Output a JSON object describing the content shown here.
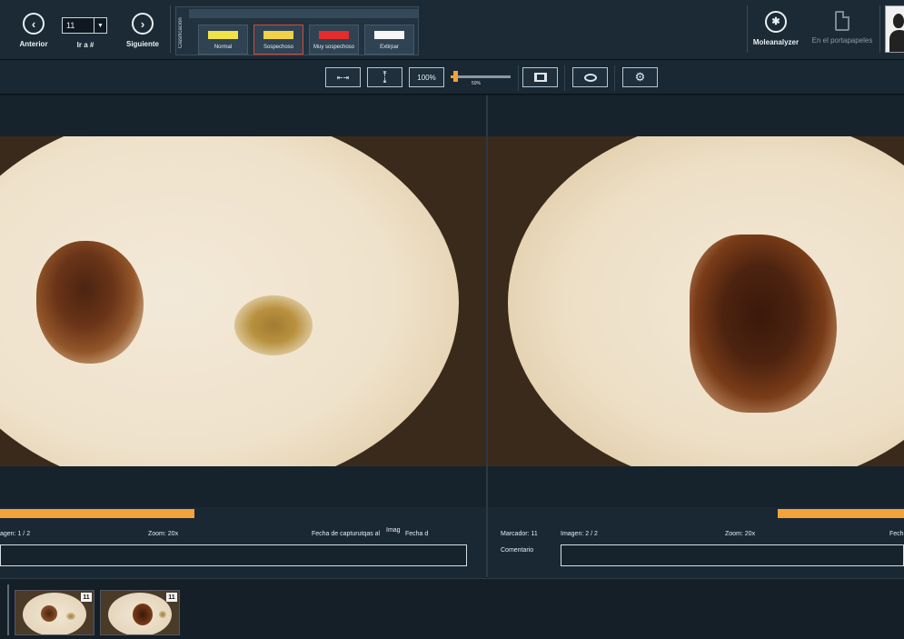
{
  "toolbar": {
    "prev_label": "Anterior",
    "next_label": "Siguiente",
    "goto_value": "11",
    "goto_label": "Ir a #",
    "classification_title": "Clasificación",
    "classification": [
      {
        "label": "Normal",
        "color": "#f1e24a",
        "selected": false
      },
      {
        "label": "Sospechoso",
        "color": "#f1d14a",
        "selected": true
      },
      {
        "label": "Muy sospechoso",
        "color": "#e52b2b",
        "selected": false
      },
      {
        "label": "Extirpar",
        "color": "#f6f6f6",
        "selected": false
      }
    ],
    "moleanalyzer_label": "Moleanalyzer",
    "clipboard_label": "En el portapapeles"
  },
  "viewbar": {
    "fit_width_icon": "fit-width-icon",
    "fit_height_icon": "fit-height-icon",
    "zoom_100_label": "100%",
    "slider_value": 0.05,
    "slider_label": "50%",
    "accent": "#f2a33a"
  },
  "left_pane": {
    "image_label": "agen: 1 / 2",
    "zoom_label": "Zoom: 20x",
    "date_label": "Fecha de capturutqas al",
    "imag_fragment": "Imag",
    "fecha_fragment": "Fecha d",
    "progress": 0.4
  },
  "right_pane": {
    "marker_label": "Marcador: 11",
    "image_label": "Imagen: 2 / 2",
    "zoom_label": "Zoom: 20x",
    "date_fragment": "Fech",
    "comment_label": "Comentario"
  },
  "thumbnails": [
    {
      "badge": "11"
    },
    {
      "badge": "11"
    }
  ]
}
